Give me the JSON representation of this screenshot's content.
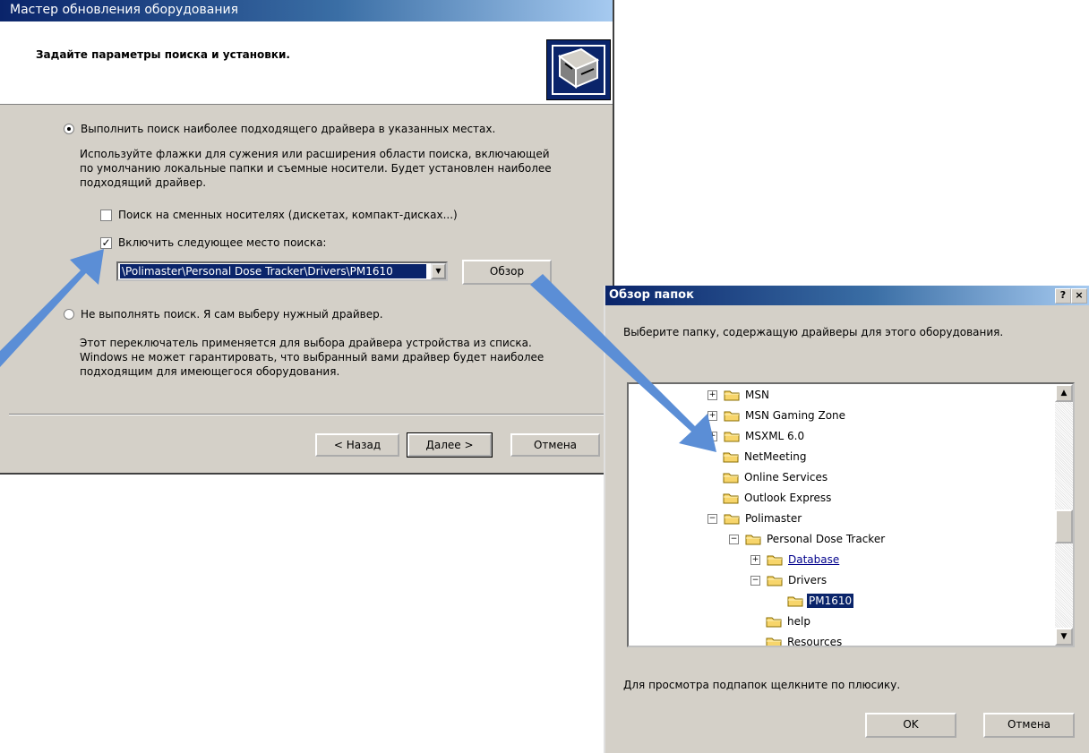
{
  "wizard": {
    "title": "Мастер обновления оборудования",
    "heading": "Задайте параметры поиска и установки.",
    "option_search": "Выполнить поиск наиболее подходящего драйвера в указанных местах.",
    "search_description": [
      "Используйте флажки для сужения или расширения области поиска, включающей",
      "по умолчанию локальные папки и съемные носители. Будет установлен наиболее",
      "подходящий драйвер."
    ],
    "checkbox_removable": "Поиск на сменных носителях (дискетах, компакт-дисках...)",
    "checkbox_include_location": "Включить следующее место поиска:",
    "location_value": "\\Polimaster\\Personal Dose Tracker\\Drivers\\PM1610",
    "browse_button": "Обзор",
    "option_manual": "Не выполнять поиск. Я сам выберу нужный драйвер.",
    "manual_description": [
      "Этот переключатель применяется для выбора драйвера устройства из списка.",
      "Windows не может гарантировать, что выбранный вами драйвер будет наиболее",
      "подходящим для имеющегося оборудования."
    ],
    "back_button": "< Назад",
    "next_button": "Далее >",
    "cancel_button": "Отмена"
  },
  "browse": {
    "title": "Обзор папок",
    "help_button": "?",
    "close_button": "×",
    "prompt": "Выберите папку, содержащую драйверы для этого оборудования.",
    "tree": [
      {
        "label": "MSN",
        "expander": "+"
      },
      {
        "label": "MSN Gaming Zone",
        "expander": "+"
      },
      {
        "label": "MSXML 6.0",
        "expander": "+"
      },
      {
        "label": "NetMeeting",
        "expander": ""
      },
      {
        "label": "Online Services",
        "expander": ""
      },
      {
        "label": "Outlook Express",
        "expander": ""
      },
      {
        "label": "Polimaster",
        "expander": "−"
      },
      {
        "label": "Personal Dose Tracker",
        "expander": "−"
      },
      {
        "label": "Database",
        "expander": "+"
      },
      {
        "label": "Drivers",
        "expander": "−"
      },
      {
        "label": "PM1610",
        "expander": ""
      },
      {
        "label": "help",
        "expander": ""
      },
      {
        "label": "Resources",
        "expander": ""
      }
    ],
    "footer": "Для просмотра подпапок щелкните по плюсику.",
    "ok_button": "OK",
    "cancel_button": "Отмена"
  },
  "colors": {
    "dialog_bg": "#d4d0c8",
    "title_start": "#0a246a",
    "title_end": "#a6caf0",
    "selection": "#0a246a",
    "annotation_arrow": "#5b8ed6"
  }
}
